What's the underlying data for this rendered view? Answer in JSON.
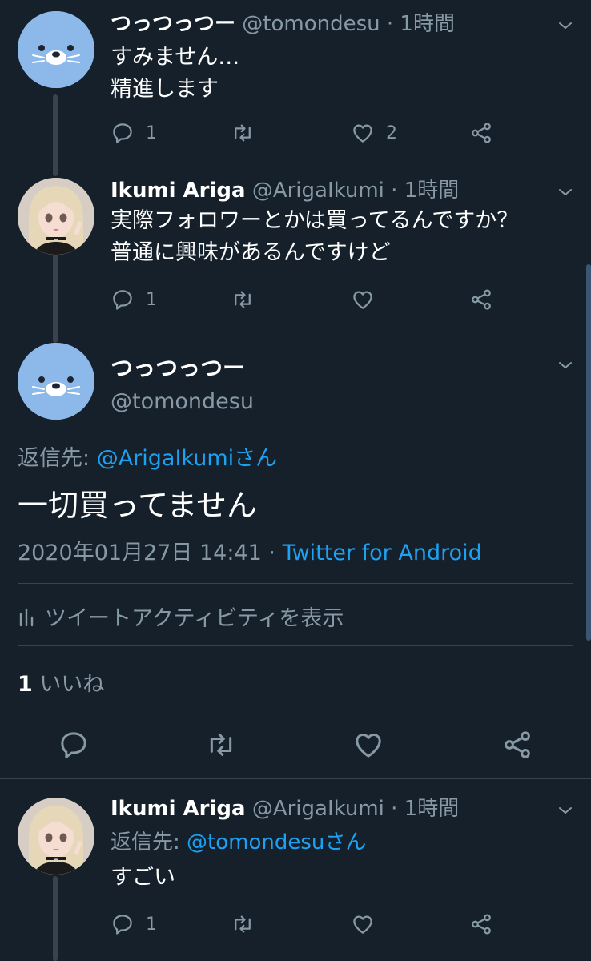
{
  "colors": {
    "background": "#15202b",
    "text": "#ffffff",
    "muted": "#8899a6",
    "link": "#1da1f2",
    "divider": "#38444d"
  },
  "tweets": [
    {
      "name": "つっつっつー",
      "handle": "@tomondesu",
      "time": "· 1時間",
      "text": "すみません…\n精進します",
      "replies": "1",
      "likes": "2",
      "avatar_icon": "seal-avatar"
    },
    {
      "name": "Ikumi Ariga",
      "handle": "@ArigaIkumi",
      "time": "· 1時間",
      "text": "実際フォロワーとかは買ってるんですか？\n普通に興味があるんですけど",
      "replies": "1",
      "likes": "",
      "avatar_icon": "anime-girl-avatar"
    }
  ],
  "focused": {
    "name": "つっつっつー",
    "handle": "@tomondesu",
    "reply_prefix": "返信先: ",
    "reply_to": "@ArigaIkumiさん",
    "text": "一切買ってません",
    "timestamp": "2020年01月27日 14:41 · ",
    "client": "Twitter for Android",
    "activity_label": "ツイートアクティビティを表示",
    "like_count": "1",
    "like_label": "いいね"
  },
  "reply": {
    "name": "Ikumi Ariga",
    "handle": "@ArigaIkumi",
    "time": "· 1時間",
    "reply_prefix": "返信先: ",
    "reply_to": "@tomondesuさん",
    "text": "すごい",
    "replies": "1",
    "likes": ""
  }
}
